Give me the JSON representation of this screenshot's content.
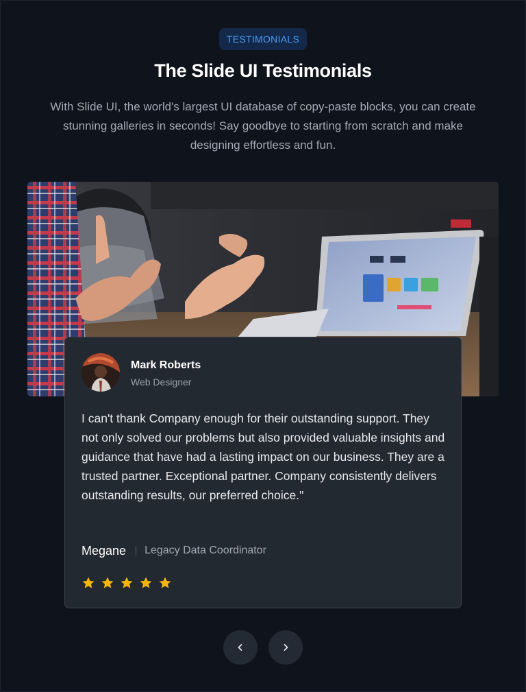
{
  "header": {
    "badge": "TESTIMONIALS",
    "title": "The Slide UI Testimonials",
    "subtitle": "With Slide UI, the world's largest UI database of copy-paste blocks, you can create stunning galleries in seconds! Say goodbye to starting from scratch and make designing effortless and fun."
  },
  "testimonial": {
    "reviewer_name": "Mark Roberts",
    "reviewer_role": "Web Designer",
    "quote": "I can't thank Company enough for their outstanding support. They not only solved our problems but also provided valuable insights and guidance that have had a lasting impact on our business. They are a trusted partner. Exceptional partner. Company consistently delivers outstanding results, our preferred choice.\"",
    "author_name": "Megane",
    "author_role": "Legacy Data Coordinator",
    "rating": 5
  },
  "colors": {
    "background": "#0f131c",
    "accent": "#4d9bf0",
    "card": "#232931",
    "star": "#f5b50a"
  },
  "icons": {
    "prev": "chevron-left-icon",
    "next": "chevron-right-icon",
    "star": "star-icon"
  }
}
